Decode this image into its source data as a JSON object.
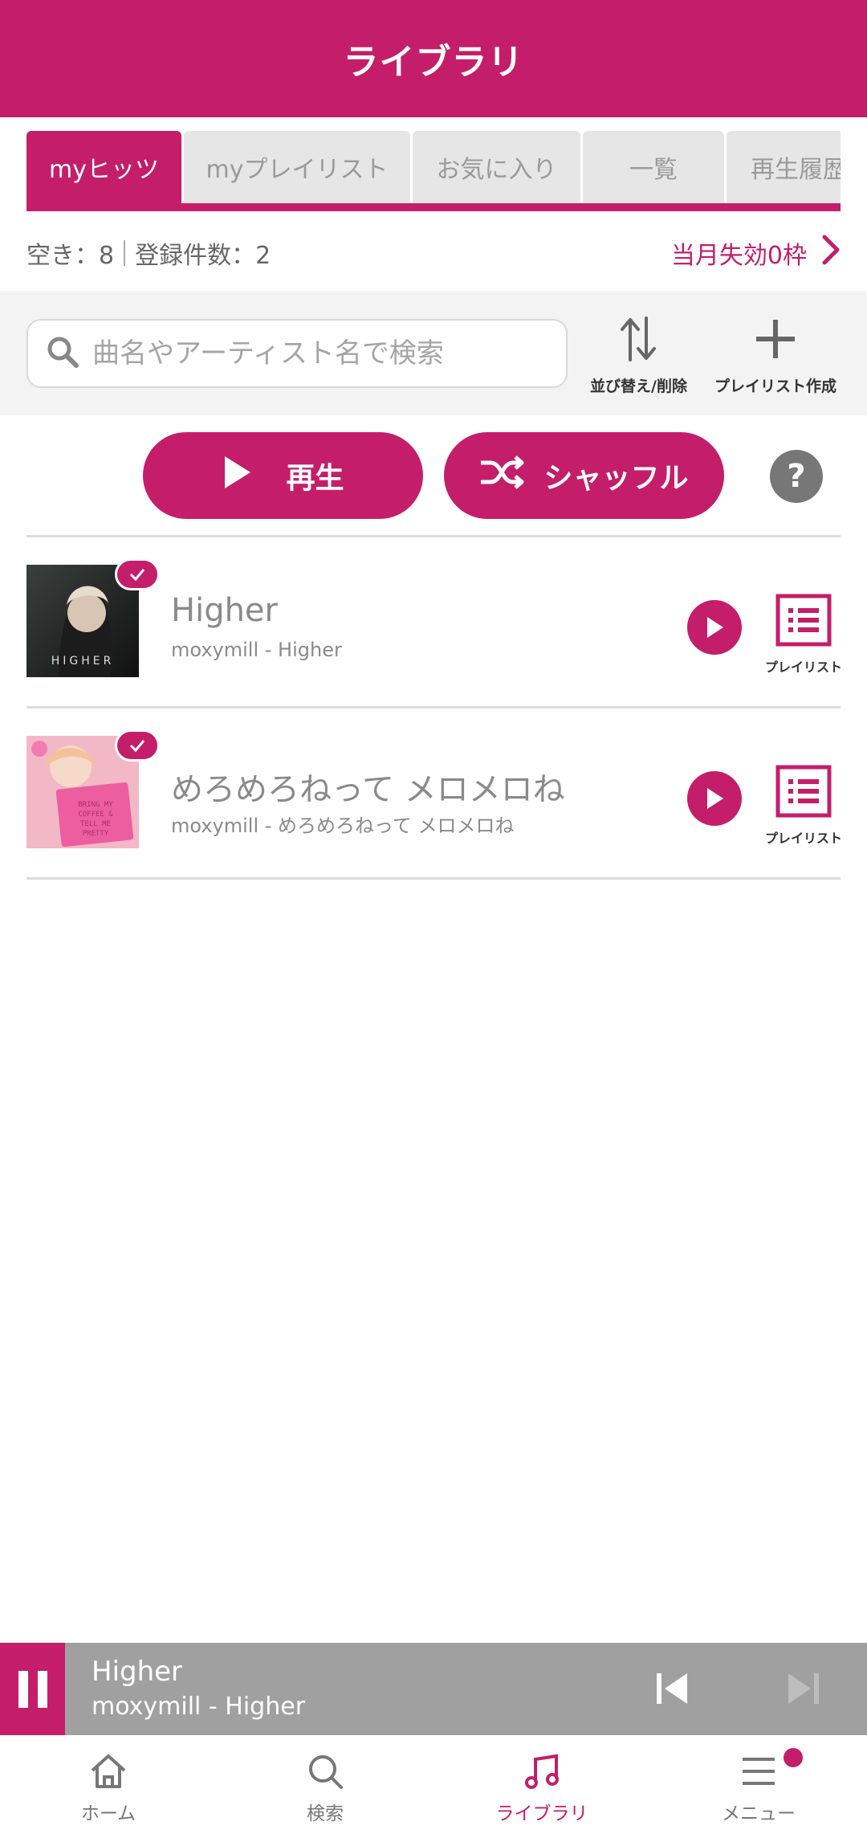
{
  "header": {
    "title": "ライブラリ"
  },
  "tabs": [
    {
      "label": "myヒッツ",
      "active": true
    },
    {
      "label": "myプレイリスト"
    },
    {
      "label": "お気に入り"
    },
    {
      "label": "一覧"
    },
    {
      "label": "再生履歴"
    }
  ],
  "counts": {
    "free": "空き：8",
    "registered": "登録件数：2"
  },
  "expire": {
    "label": "当月失効0枠"
  },
  "search": {
    "placeholder": "曲名やアーティスト名で検索"
  },
  "tools": {
    "sort_label": "並び替え/削除",
    "create_playlist_label": "プレイリスト作成"
  },
  "actions": {
    "play_label": "再生",
    "shuffle_label": "シャッフル",
    "help_label": "?"
  },
  "songs": [
    {
      "title": "Higher",
      "subtitle": "moxymill - Higher",
      "playlist_label": "プレイリスト"
    },
    {
      "title": "めろめろねって メロメロね",
      "subtitle": "moxymill - めろめろねって メロメロね",
      "playlist_label": "プレイリスト"
    }
  ],
  "now_playing": {
    "title": "Higher",
    "subtitle": "moxymill - Higher"
  },
  "nav": [
    {
      "label": "ホーム"
    },
    {
      "label": "検索"
    },
    {
      "label": "ライブラリ",
      "active": true
    },
    {
      "label": "メニュー"
    }
  ],
  "colors": {
    "accent": "#c41e6a",
    "player_bg": "#a0a0a0"
  }
}
